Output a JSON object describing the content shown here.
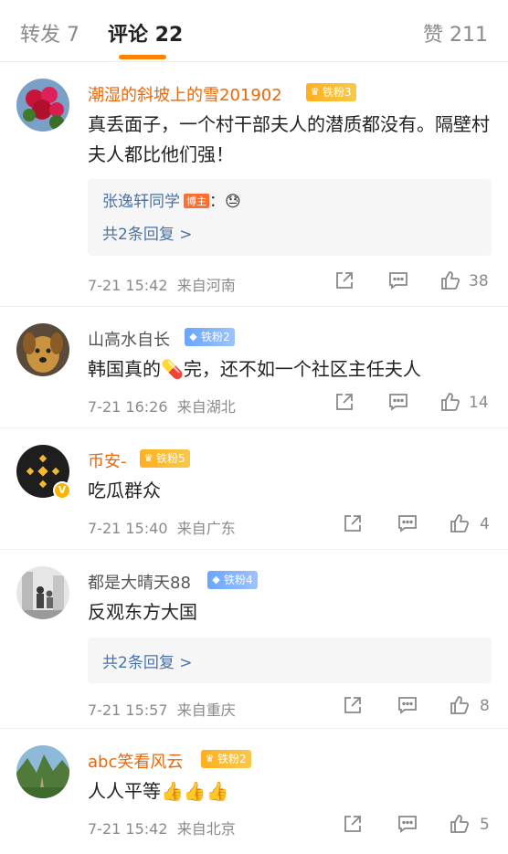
{
  "tabs": {
    "repost": "转发 7",
    "comments": "评论 22",
    "likes": "赞 211"
  },
  "colors": {
    "accent": "#ff8200",
    "link": "#4a72a8",
    "orange_name": "#e8680c"
  },
  "comments": [
    {
      "username": "潮湿的斜坡上的雪201902",
      "fan_badge": "铁粉3",
      "text": "真丢面子，一个村干部夫人的潜质都没有。隔壁村夫人都比他们强！",
      "reply": {
        "user": "张逸轩同学",
        "host_tag": "博主",
        "text": "：😓",
        "more": "共2条回复 >"
      },
      "time": "7-21 15:42",
      "location": "来自河南",
      "likes": "38"
    },
    {
      "username": "山高水自长",
      "fan_badge": "铁粉2",
      "text": "韩国真的💊完，还不如一个社区主任夫人",
      "time": "7-21 16:26",
      "location": "来自湖北",
      "likes": "14"
    },
    {
      "username": "币安-",
      "fan_badge": "铁粉5",
      "text": "吃瓜群众",
      "time": "7-21 15:40",
      "location": "来自广东",
      "likes": "4"
    },
    {
      "username": "都是大晴天88",
      "fan_badge": "铁粉4",
      "text": "反观东方大国",
      "reply": {
        "more": "共2条回复 >"
      },
      "time": "7-21 15:57",
      "location": "来自重庆",
      "likes": "8"
    },
    {
      "username": "abc笑看风云",
      "fan_badge": "铁粉2",
      "text": "人人平等👍👍👍",
      "time": "7-21 15:42",
      "location": "来自北京",
      "likes": "5"
    }
  ]
}
